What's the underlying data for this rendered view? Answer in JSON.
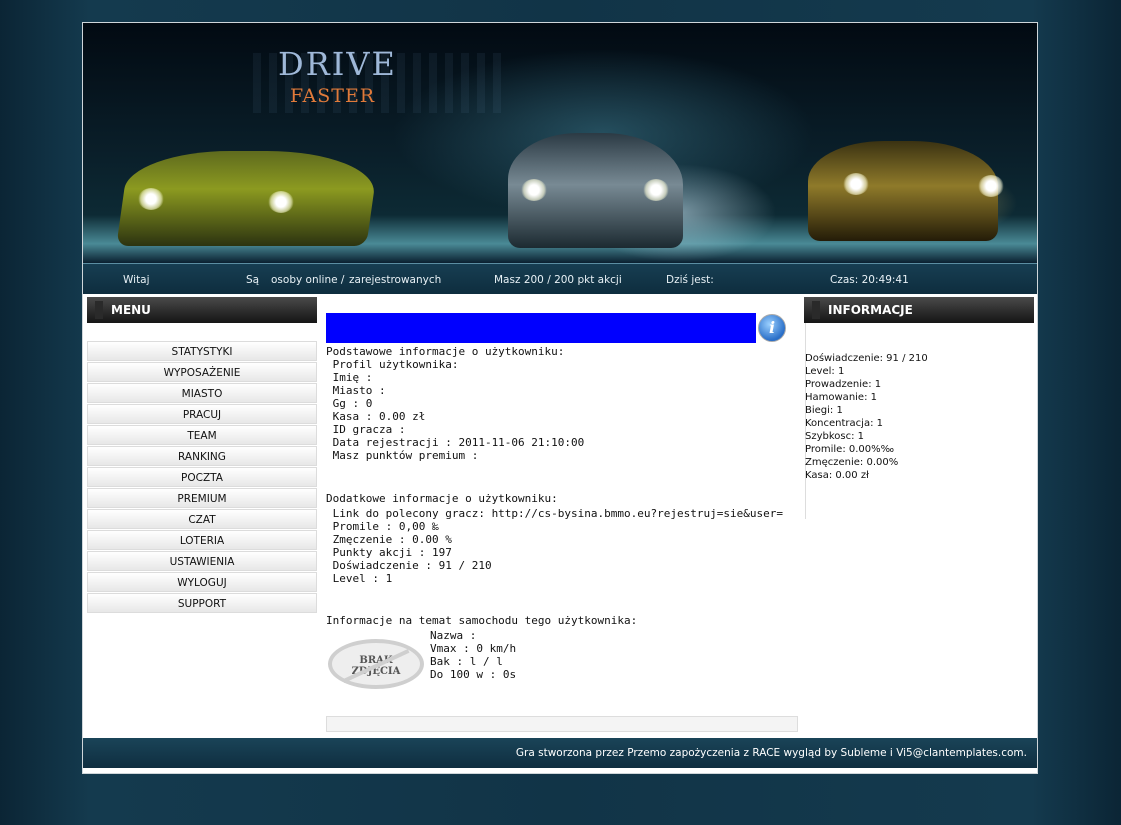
{
  "banner": {
    "logo_top": "DRIVE",
    "logo_bottom": "FASTER"
  },
  "infobar": {
    "welcome": "Witaj",
    "online_prefix": "Są",
    "online_mid": "osoby online /",
    "registered": "zarejestrowanych",
    "actions": "Masz 200 / 200 pkt akcji",
    "today": "Dziś jest:",
    "time": "Czas: 20:49:41"
  },
  "menu": {
    "title": "MENU",
    "items": [
      "STATYSTYKI",
      "WYPOSAŻENIE",
      "MIASTO",
      "PRACUJ",
      "TEAM",
      "RANKING",
      "POCZTA",
      "PREMIUM",
      "CZAT",
      "LOTERIA",
      "USTAWIENIA",
      "WYLOGUJ",
      "SUPPORT"
    ]
  },
  "main": {
    "info_icon": "i",
    "basic_title": "Podstawowe informacje o użytkowniku:",
    "basic_lines": [
      " Profil użytkownika:",
      " Imię :",
      " Miasto :",
      " Gg : 0",
      " Kasa : 0.00 zł",
      " ID gracza :",
      " Data rejestracji : 2011-11-06 21:10:00",
      " Masz punktów premium :"
    ],
    "extra_title": "Dodatkowe informacje o użytkowniku:",
    "extra_lines": [
      " Link do polecony gracz: http://cs-bysina.bmmo.eu?rejestruj=sie&user=",
      " Promile : 0,00 ‰",
      " Zmęczenie : 0.00 %",
      " Punkty akcji : 197",
      " Doświadczenie : 91 / 210",
      " Level : 1"
    ],
    "car_title": "Informacje na temat samochodu tego użytkownika:",
    "no_photo_line1": "BRAK",
    "no_photo_line2": "ZDJĘCIA",
    "car_lines": [
      "Nazwa :",
      "Vmax : 0 km/h",
      "Bak : l / l",
      "Do 100 w : 0s"
    ]
  },
  "info": {
    "title": "INFORMACJE",
    "lines": [
      "Doświadczenie: 91 / 210",
      "Level: 1",
      "Prowadzenie: 1",
      "Hamowanie: 1",
      "Biegi: 1",
      "Koncentracja: 1",
      "Szybkosc: 1",
      "Promile: 0.00%‰",
      "Zmęczenie: 0.00%",
      "Kasa: 0.00 zł"
    ]
  },
  "footer": {
    "credits": "Gra stworzona przez Przemo zapożyczenia z RACE wygląd by Subleme i Vi5@clantemplates.com."
  },
  "colors": {
    "bar_blue": "#0000ff",
    "logo_blue": "#9fb8d8",
    "logo_orange": "#e07a3a"
  }
}
